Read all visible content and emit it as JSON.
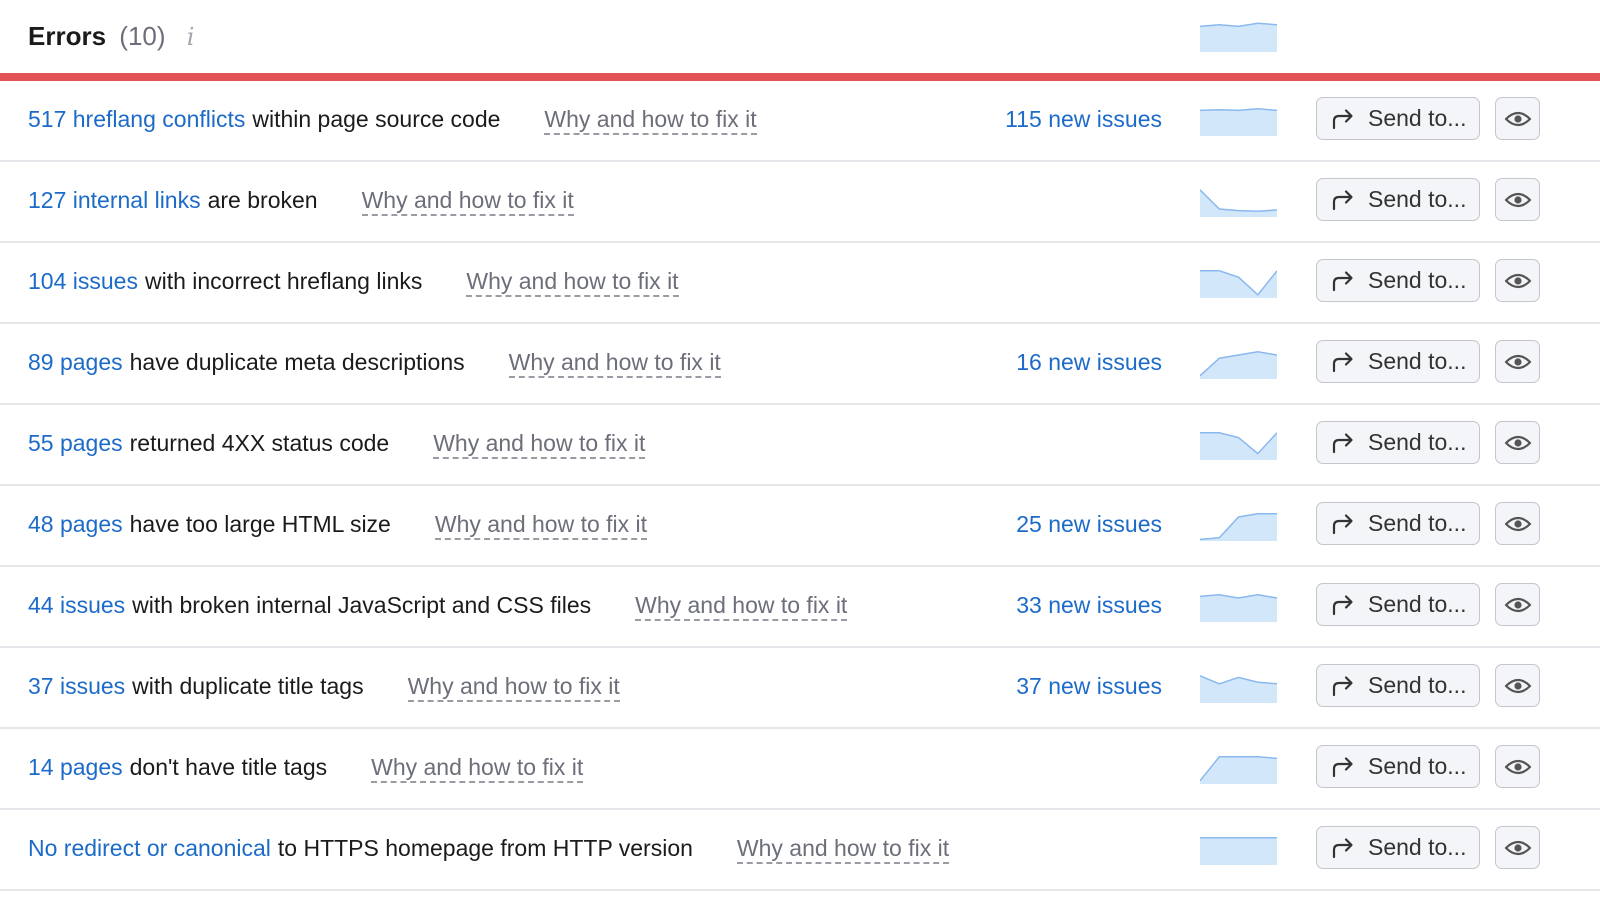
{
  "header": {
    "title": "Errors",
    "count": "(10)",
    "info_icon": "info-icon",
    "trend": [
      0.8,
      0.85,
      0.8,
      0.9,
      0.85
    ]
  },
  "colors": {
    "accent_red": "#e35355",
    "link_blue": "#1d6bc9",
    "spark_fill": "#d3e7fb",
    "spark_line": "#8ab8ee"
  },
  "rows": [
    {
      "link": "517 hreflang conflicts",
      "text": "within page source code",
      "fix": "Why and how to fix it",
      "new_issues": "115 new issues",
      "send": "Send to...",
      "trend": [
        0.8,
        0.82,
        0.8,
        0.85,
        0.8
      ]
    },
    {
      "link": "127 internal links",
      "text": "are broken",
      "fix": "Why and how to fix it",
      "new_issues": "",
      "send": "Send to...",
      "trend": [
        0.85,
        0.25,
        0.2,
        0.18,
        0.22
      ]
    },
    {
      "link": "104 issues",
      "text": "with incorrect hreflang links",
      "fix": "Why and how to fix it",
      "new_issues": "",
      "send": "Send to...",
      "trend": [
        0.85,
        0.85,
        0.65,
        0.1,
        0.85
      ]
    },
    {
      "link": "89 pages",
      "text": "have duplicate meta descriptions",
      "fix": "Why and how to fix it",
      "new_issues": "16 new issues",
      "send": "Send to...",
      "trend": [
        0.1,
        0.65,
        0.75,
        0.85,
        0.75
      ]
    },
    {
      "link": "55 pages",
      "text": "returned 4XX status code",
      "fix": "Why and how to fix it",
      "new_issues": "",
      "send": "Send to...",
      "trend": [
        0.85,
        0.85,
        0.7,
        0.2,
        0.85
      ]
    },
    {
      "link": "48 pages",
      "text": "have too large HTML size",
      "fix": "Why and how to fix it",
      "new_issues": "25 new issues",
      "send": "Send to...",
      "trend": [
        0.05,
        0.1,
        0.75,
        0.85,
        0.85
      ]
    },
    {
      "link": "44 issues",
      "text": "with broken internal JavaScript and CSS files",
      "fix": "Why and how to fix it",
      "new_issues": "33 new issues",
      "send": "Send to...",
      "trend": [
        0.8,
        0.85,
        0.75,
        0.85,
        0.75
      ]
    },
    {
      "link": "37 issues",
      "text": "with duplicate title tags",
      "fix": "Why and how to fix it",
      "new_issues": "37 new issues",
      "send": "Send to...",
      "trend": [
        0.85,
        0.6,
        0.8,
        0.65,
        0.6
      ]
    },
    {
      "link": "14 pages",
      "text": "don't have title tags",
      "fix": "Why and how to fix it",
      "new_issues": "",
      "send": "Send to...",
      "trend": [
        0.1,
        0.85,
        0.85,
        0.85,
        0.8
      ]
    },
    {
      "link": "No redirect or canonical",
      "text": "to HTTPS homepage from HTTP version",
      "fix": "Why and how to fix it",
      "new_issues": "",
      "send": "Send to...",
      "trend": [
        0.85,
        0.85,
        0.85,
        0.85,
        0.85
      ]
    }
  ]
}
